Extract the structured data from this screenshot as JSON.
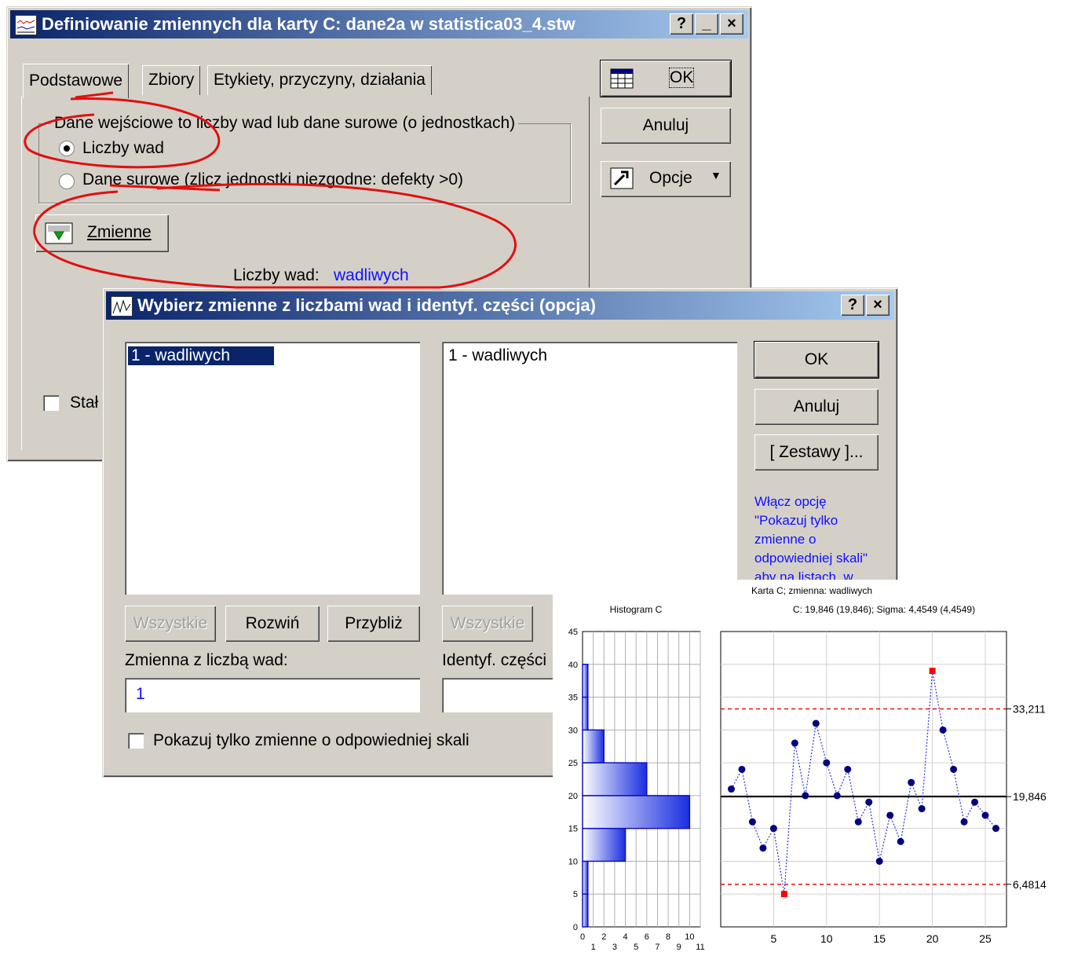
{
  "dialog1": {
    "title": "Definiowanie zmiennych dla karty C: dane2a w statistica03_4.stw",
    "title_buttons": [
      "?",
      "_",
      "×"
    ],
    "tabs": [
      "Podstawowe",
      "Zbiory",
      "Etykiety, przyczyny, działania"
    ],
    "group_title": "Dane wejściowe to liczby wad lub dane surowe (o jednostkach)",
    "radio1": "Liczby wad",
    "radio2": "Dane surowe (zlicz jednostki niezgodne: defekty >0)",
    "variables_button": "Zmienne",
    "var_label": "Liczby wad:",
    "var_value": "wadliwych",
    "checkbox_partial": "Stał",
    "ok": "OK",
    "cancel": "Anuluj",
    "options": "Opcje"
  },
  "dialog2": {
    "title": "Wybierz zmienne z liczbami wad i identyf. części (opcja)",
    "title_buttons": [
      "?",
      "×"
    ],
    "list1_item": "1 - wadliwych",
    "list2_item": "1 - wadliwych",
    "btn_all1": "Wszystkie",
    "btn_expand": "Rozwiń",
    "btn_zoom": "Przybliż",
    "btn_all2": "Wszystkie",
    "field1_label": "Zmienna z liczbą wad:",
    "field1_value": "1",
    "field2_label": "Identyf. części",
    "checkbox_label": "Pokazuj tylko zmienne o odpowiedniej skali",
    "ok": "OK",
    "cancel": "Anuluj",
    "sets": "[ Zestawy ]...",
    "hint_lines": [
      "Włącz opcję",
      "\"Pokazuj tylko",
      "zmienne o",
      "odpowiedniej skali\"",
      "aby na listach, w"
    ]
  },
  "colors": {
    "title_start": "#0a246a",
    "title_end": "#a6caf0",
    "annotation": "#e01010",
    "link": "#1010ff",
    "point": "#000080",
    "out_point": "#ff0000"
  },
  "icons": [
    "window-icon",
    "help-icon",
    "minimize-icon",
    "close-icon",
    "table-icon",
    "tools-icon",
    "dropdown-arrow-icon",
    "variables-icon",
    "chart-icon"
  ],
  "chart_data": [
    {
      "type": "bar",
      "title": "Karta C; zmienna:  wadliwych",
      "subtitle": "Histogram C",
      "orientation": "horizontal",
      "bins": [
        [
          0,
          5
        ],
        [
          5,
          10
        ],
        [
          10,
          15
        ],
        [
          15,
          20
        ],
        [
          20,
          25
        ],
        [
          25,
          30
        ],
        [
          30,
          35
        ],
        [
          35,
          40
        ]
      ],
      "values": [
        0.5,
        0.5,
        4,
        10,
        6,
        2,
        0.5,
        0.5
      ],
      "ylim": [
        0,
        45
      ],
      "yticks": [
        0,
        5,
        10,
        15,
        20,
        25,
        30,
        35,
        40,
        45
      ],
      "xticks_top": [
        "0",
        "2",
        "4",
        "6",
        "8",
        "10"
      ],
      "xticks_bottom": [
        "1",
        "3",
        "5",
        "7",
        "9",
        "11"
      ]
    },
    {
      "type": "line",
      "subtitle": "C: 19,846 (19,846); Sigma: 4,4549 (4,4549)",
      "x": [
        1,
        2,
        3,
        4,
        5,
        6,
        7,
        8,
        9,
        10,
        11,
        12,
        13,
        14,
        15,
        16,
        17,
        18,
        19,
        20,
        21,
        22,
        23,
        24,
        25,
        26
      ],
      "y": [
        21,
        24,
        16,
        12,
        15,
        5,
        28,
        20,
        31,
        25,
        20,
        24,
        16,
        19,
        10,
        17,
        13,
        22,
        18,
        39,
        30,
        24,
        16,
        19,
        17,
        15
      ],
      "out_of_control_x": [
        6,
        20
      ],
      "xticks": [
        5,
        10,
        15,
        20,
        25
      ],
      "xlim": [
        0,
        27
      ],
      "ylim": [
        0,
        45
      ],
      "lines": [
        {
          "label": "33,211",
          "value": 33.211,
          "style": "dashed-red"
        },
        {
          "label": "19,846",
          "value": 19.846,
          "style": "solid-black"
        },
        {
          "label": "6,4814",
          "value": 6.4814,
          "style": "dashed-red"
        }
      ]
    }
  ]
}
